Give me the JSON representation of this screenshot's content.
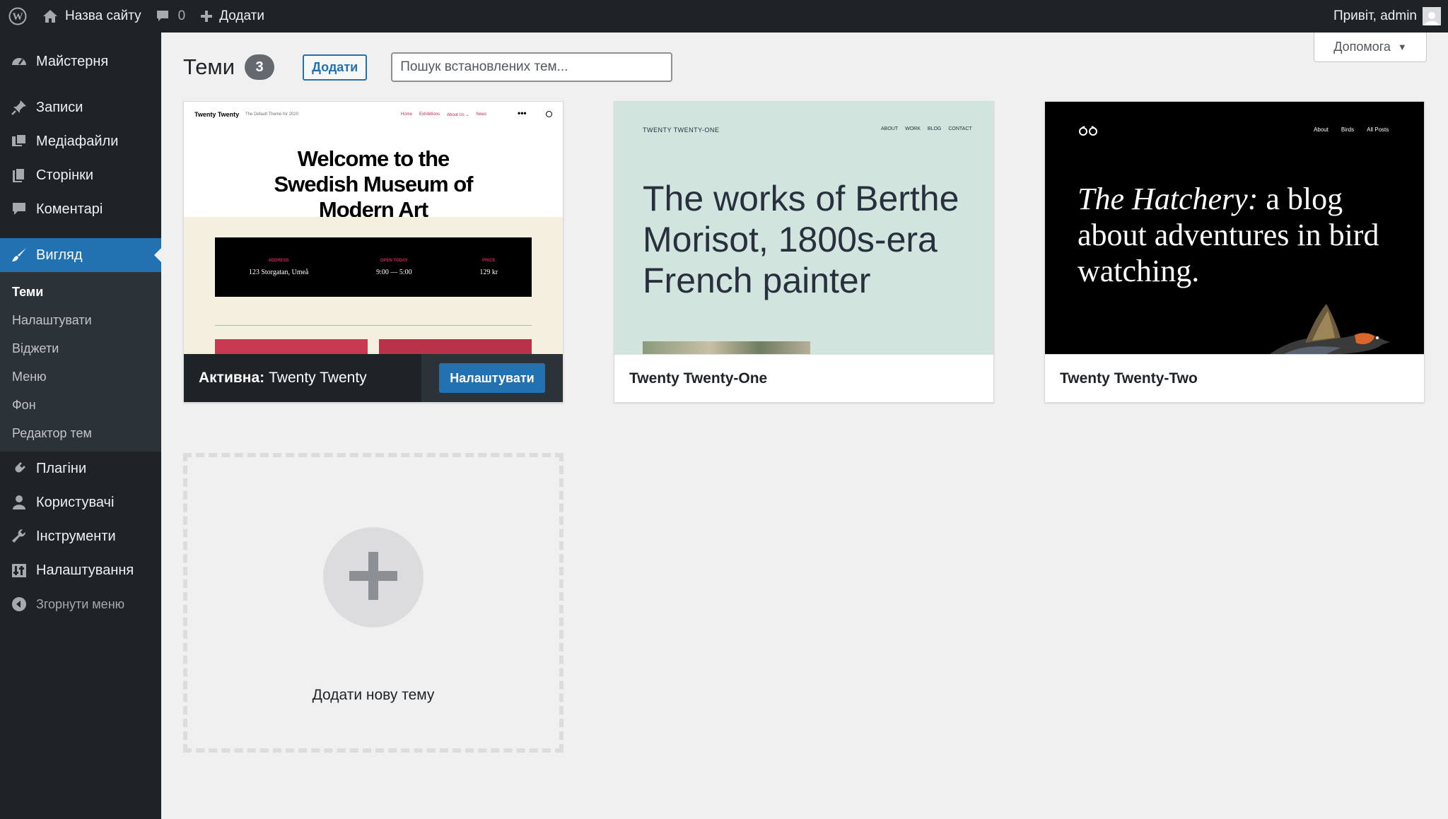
{
  "admin_bar": {
    "site_name": "Назва сайту",
    "comments_count": "0",
    "new_label": "Додати",
    "greeting": "Привіт, admin"
  },
  "sidebar": {
    "items": [
      {
        "label": "Майстерня",
        "icon": "dashboard-icon"
      },
      {
        "label": "Записи",
        "icon": "pin-icon"
      },
      {
        "label": "Медіафайли",
        "icon": "media-icon"
      },
      {
        "label": "Сторінки",
        "icon": "pages-icon"
      },
      {
        "label": "Коментарі",
        "icon": "comment-icon"
      },
      {
        "label": "Вигляд",
        "icon": "brush-icon"
      },
      {
        "label": "Плагіни",
        "icon": "plugin-icon"
      },
      {
        "label": "Користувачі",
        "icon": "users-icon"
      },
      {
        "label": "Інструменти",
        "icon": "wrench-icon"
      },
      {
        "label": "Налаштування",
        "icon": "settings-icon"
      }
    ],
    "submenu": [
      "Теми",
      "Налаштувати",
      "Віджети",
      "Меню",
      "Фон",
      "Редактор тем"
    ],
    "collapse_label": "Згорнути меню"
  },
  "help_tab": {
    "label": "Допомога"
  },
  "page": {
    "title": "Теми",
    "count": "3",
    "add_button": "Додати",
    "search_placeholder": "Пошук встановлених тем..."
  },
  "themes": [
    {
      "name": "Twenty Twenty",
      "active_prefix": "Активна:",
      "customize_label": "Налаштувати",
      "preview": {
        "brand": "Twenty Twenty",
        "tagline": "The Default Theme for 2020",
        "nav": [
          "Home",
          "Exhibitions",
          "About Us ⌄",
          "News"
        ],
        "heading": "Welcome to the Swedish Museum of Modern Art",
        "info": [
          {
            "label": "ADDRESS",
            "value": "123 Storgatan, Umeå"
          },
          {
            "label": "OPEN TODAY",
            "value": "9:00 — 5:00"
          },
          {
            "label": "PRICE",
            "value": "129 kr"
          }
        ]
      }
    },
    {
      "name": "Twenty Twenty-One",
      "preview": {
        "site": "TWENTY TWENTY-ONE",
        "nav": [
          "ABOUT",
          "WORK",
          "BLOG",
          "CONTACT"
        ],
        "heading": "The works of Berthe Morisot, 1800s-era French painter"
      }
    },
    {
      "name": "Twenty Twenty-Two",
      "preview": {
        "nav": [
          "About",
          "Birds",
          "All Posts"
        ],
        "heading_italic": "The Hatchery:",
        "heading_rest": " a blog about adventures in bird watching."
      }
    }
  ],
  "add_new_theme": {
    "label": "Додати нову тему"
  },
  "colors": {
    "accent": "#2271b1",
    "admin_dark": "#1d2327",
    "submenu_bg": "#2c3338",
    "background": "#f0f0f1"
  }
}
